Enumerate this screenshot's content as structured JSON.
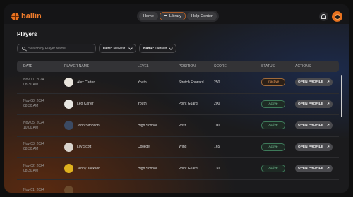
{
  "app": {
    "logo_text": "ballin"
  },
  "nav": {
    "items": [
      {
        "label": "Home"
      },
      {
        "label": "Library"
      },
      {
        "label": "Help Center"
      }
    ]
  },
  "page": {
    "title": "Players"
  },
  "filters": {
    "search_placeholder": "Search by Player Name",
    "date_label": "Date:",
    "date_value": "Newest",
    "name_label": "Name:",
    "name_value": "Default"
  },
  "table": {
    "headers": [
      "DATE",
      "PLAYER NAME",
      "LEVEL",
      "POSITION",
      "SCORE",
      "STATUS",
      "ACTIONS"
    ],
    "action_label": "OPEN PROFILE",
    "rows": [
      {
        "date": "Nov 11, 2024",
        "time": "08:30 AM",
        "name": "Alex Carter",
        "level": "Youth",
        "position": "Stretch Forward",
        "score": "250",
        "status": "Inactive",
        "avatar_color": "#e9e4dc"
      },
      {
        "date": "Nov 08, 2024",
        "time": "08:30 AM",
        "name": "Leo Carter",
        "level": "Youth",
        "position": "Point Guard",
        "score": "200",
        "status": "Active",
        "avatar_color": "#e8e6e1"
      },
      {
        "date": "Nov 05, 2024",
        "time": "10:00 AM",
        "name": "John Simpson",
        "level": "High School",
        "position": "Post",
        "score": "100",
        "status": "Active",
        "avatar_color": "#3b4a63"
      },
      {
        "date": "Nov 03, 2024",
        "time": "08:30 AM",
        "name": "Lily Scott",
        "level": "College",
        "position": "Wing",
        "score": "165",
        "status": "Active",
        "avatar_color": "#d9d3cc"
      },
      {
        "date": "Nov 02, 2024",
        "time": "08:30 AM",
        "name": "Jenny Jackson",
        "level": "High School",
        "position": "Point Guard",
        "score": "130",
        "status": "Active",
        "avatar_color": "#e0b21e"
      },
      {
        "date": "Nov 01, 2024",
        "time": "",
        "name": "",
        "level": "",
        "position": "",
        "score": "",
        "status": "",
        "avatar_color": "#6b4a2c"
      }
    ]
  },
  "colors": {
    "accent": "#e8721f",
    "active": "#79c99a",
    "inactive": "#e49454"
  }
}
